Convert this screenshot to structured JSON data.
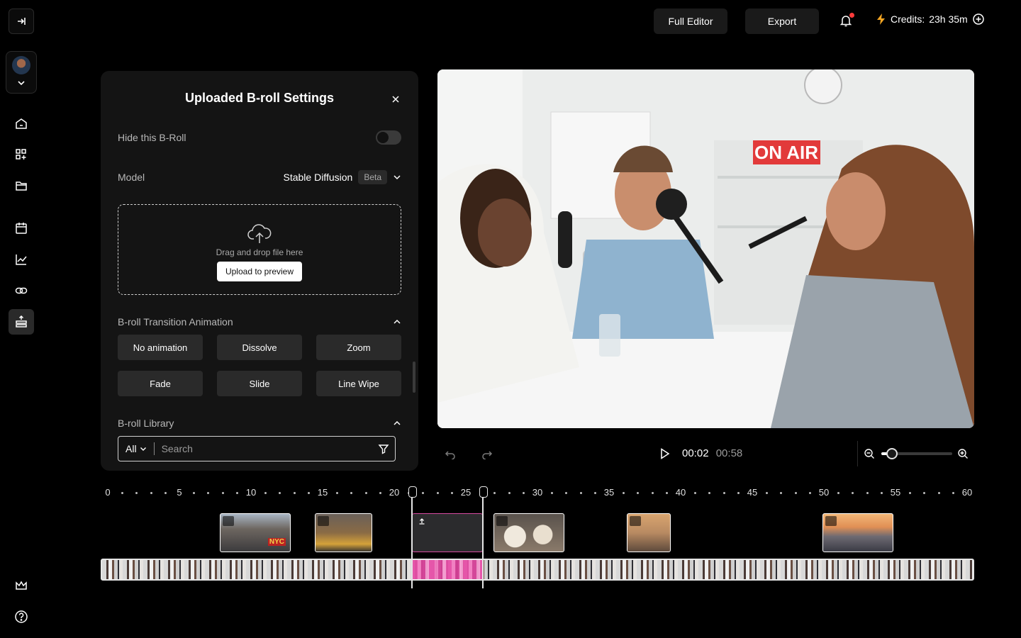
{
  "topbar": {
    "full_editor": "Full Editor",
    "export": "Export",
    "credits_label": "Credits:",
    "credits_value": "23h 35m"
  },
  "rail": {
    "items": [
      "home-icon",
      "apps-icon",
      "folder-icon",
      "calendar-icon",
      "analytics-icon",
      "link-icon",
      "broll-icon"
    ],
    "bottom": [
      "crown-icon",
      "help-icon"
    ]
  },
  "panel": {
    "title": "Uploaded B-roll Settings",
    "hide_label": "Hide this B-Roll",
    "hide_enabled": false,
    "model_label": "Model",
    "model_value": "Stable Diffusion",
    "model_badge": "Beta",
    "dropzone_text": "Drag and drop file here",
    "upload_button": "Upload to preview",
    "transition_heading": "B-roll Transition Animation",
    "animations": [
      "No animation",
      "Dissolve",
      "Zoom",
      "Fade",
      "Slide",
      "Line Wipe"
    ],
    "library_heading": "B-roll Library",
    "filter_value": "All",
    "search_placeholder": "Search"
  },
  "video": {
    "sign_text": "ON AIR"
  },
  "player": {
    "current_time": "00:02",
    "duration": "00:58",
    "zoom_level": 0.15
  },
  "timeline": {
    "ticks": [
      "0",
      "5",
      "10",
      "15",
      "20",
      "25",
      "30",
      "35",
      "40",
      "45",
      "50",
      "55",
      "60"
    ],
    "clips": [
      {
        "label": "NYC",
        "kind": "city-street"
      },
      {
        "label": "",
        "kind": "taxi"
      },
      {
        "label": "",
        "kind": "uploaded-selected"
      },
      {
        "label": "",
        "kind": "food"
      },
      {
        "label": "",
        "kind": "interior"
      },
      {
        "label": "",
        "kind": "skyline"
      }
    ]
  }
}
